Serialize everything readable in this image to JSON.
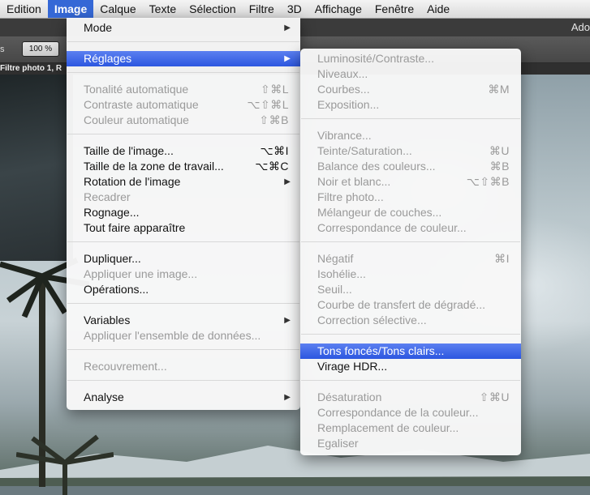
{
  "menubar": {
    "items": [
      "Edition",
      "Image",
      "Calque",
      "Texte",
      "Sélection",
      "Filtre",
      "3D",
      "Affichage",
      "Fenêtre",
      "Aide"
    ],
    "active": "Image"
  },
  "appbar": {
    "title": "Ado"
  },
  "optionsbar": {
    "left_label": "s",
    "zoom": "100 %"
  },
  "document": {
    "tab": "Filtre photo 1, R"
  },
  "image_menu": {
    "items": [
      {
        "label": "Mode",
        "submenu": true
      },
      {
        "label": "Réglages",
        "submenu": true,
        "highlighted": true
      },
      {
        "label": "Tonalité automatique",
        "shortcut": "⇧⌘L",
        "disabled": true
      },
      {
        "label": "Contraste automatique",
        "shortcut": "⌥⇧⌘L",
        "disabled": true
      },
      {
        "label": "Couleur automatique",
        "shortcut": "⇧⌘B",
        "disabled": true
      },
      {
        "label": "Taille de l'image...",
        "shortcut": "⌥⌘I"
      },
      {
        "label": "Taille de la zone de travail...",
        "shortcut": "⌥⌘C"
      },
      {
        "label": "Rotation de l'image",
        "submenu": true
      },
      {
        "label": "Recadrer",
        "disabled": true
      },
      {
        "label": "Rognage..."
      },
      {
        "label": "Tout faire apparaître"
      },
      {
        "label": "Dupliquer..."
      },
      {
        "label": "Appliquer une image...",
        "disabled": true
      },
      {
        "label": "Opérations..."
      },
      {
        "label": "Variables",
        "submenu": true
      },
      {
        "label": "Appliquer l'ensemble de données...",
        "disabled": true
      },
      {
        "label": "Recouvrement...",
        "disabled": true
      },
      {
        "label": "Analyse",
        "submenu": true
      }
    ]
  },
  "reglages_menu": {
    "items": [
      {
        "label": "Luminosité/Contraste...",
        "disabled": true
      },
      {
        "label": "Niveaux...",
        "disabled": true
      },
      {
        "label": "Courbes...",
        "shortcut": "⌘M",
        "disabled": true
      },
      {
        "label": "Exposition...",
        "disabled": true
      },
      {
        "label": "Vibrance...",
        "disabled": true
      },
      {
        "label": "Teinte/Saturation...",
        "shortcut": "⌘U",
        "disabled": true
      },
      {
        "label": "Balance des couleurs...",
        "shortcut": "⌘B",
        "disabled": true
      },
      {
        "label": "Noir et blanc...",
        "shortcut": "⌥⇧⌘B",
        "disabled": true
      },
      {
        "label": "Filtre photo...",
        "disabled": true
      },
      {
        "label": "Mélangeur de couches...",
        "disabled": true
      },
      {
        "label": "Correspondance de couleur...",
        "disabled": true
      },
      {
        "label": "Négatif",
        "shortcut": "⌘I",
        "disabled": true
      },
      {
        "label": "Isohélie...",
        "disabled": true
      },
      {
        "label": "Seuil...",
        "disabled": true
      },
      {
        "label": "Courbe de transfert de dégradé...",
        "disabled": true
      },
      {
        "label": "Correction sélective...",
        "disabled": true
      },
      {
        "label": "Tons foncés/Tons clairs...",
        "highlighted": true
      },
      {
        "label": "Virage HDR..."
      },
      {
        "label": "Désaturation",
        "shortcut": "⇧⌘U",
        "disabled": true
      },
      {
        "label": "Correspondance de la couleur...",
        "disabled": true
      },
      {
        "label": "Remplacement de couleur...",
        "disabled": true
      },
      {
        "label": "Egaliser",
        "disabled": true
      }
    ]
  },
  "colors": {
    "highlight": "#3568d6",
    "disabled_text": "#9a9a9a"
  }
}
